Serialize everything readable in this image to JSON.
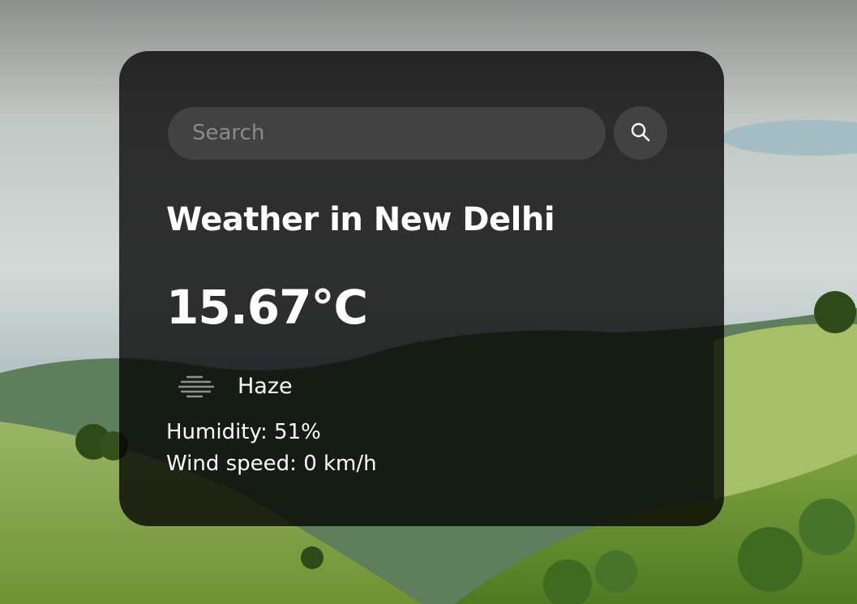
{
  "search": {
    "placeholder": "Search",
    "value": ""
  },
  "icons": {
    "search_button": "search-icon",
    "condition": "haze-icon"
  },
  "weather": {
    "title": "Weather in New Delhi",
    "temperature": "15.67°C",
    "condition": "Haze",
    "humidity_label": "Humidity: ",
    "humidity_value": "51%",
    "wind_label": "Wind speed: ",
    "wind_value": "0 km/h"
  },
  "colors": {
    "card_background": "#1e1e1e",
    "text": "#ffffff",
    "placeholder": "#8a8a8a"
  }
}
